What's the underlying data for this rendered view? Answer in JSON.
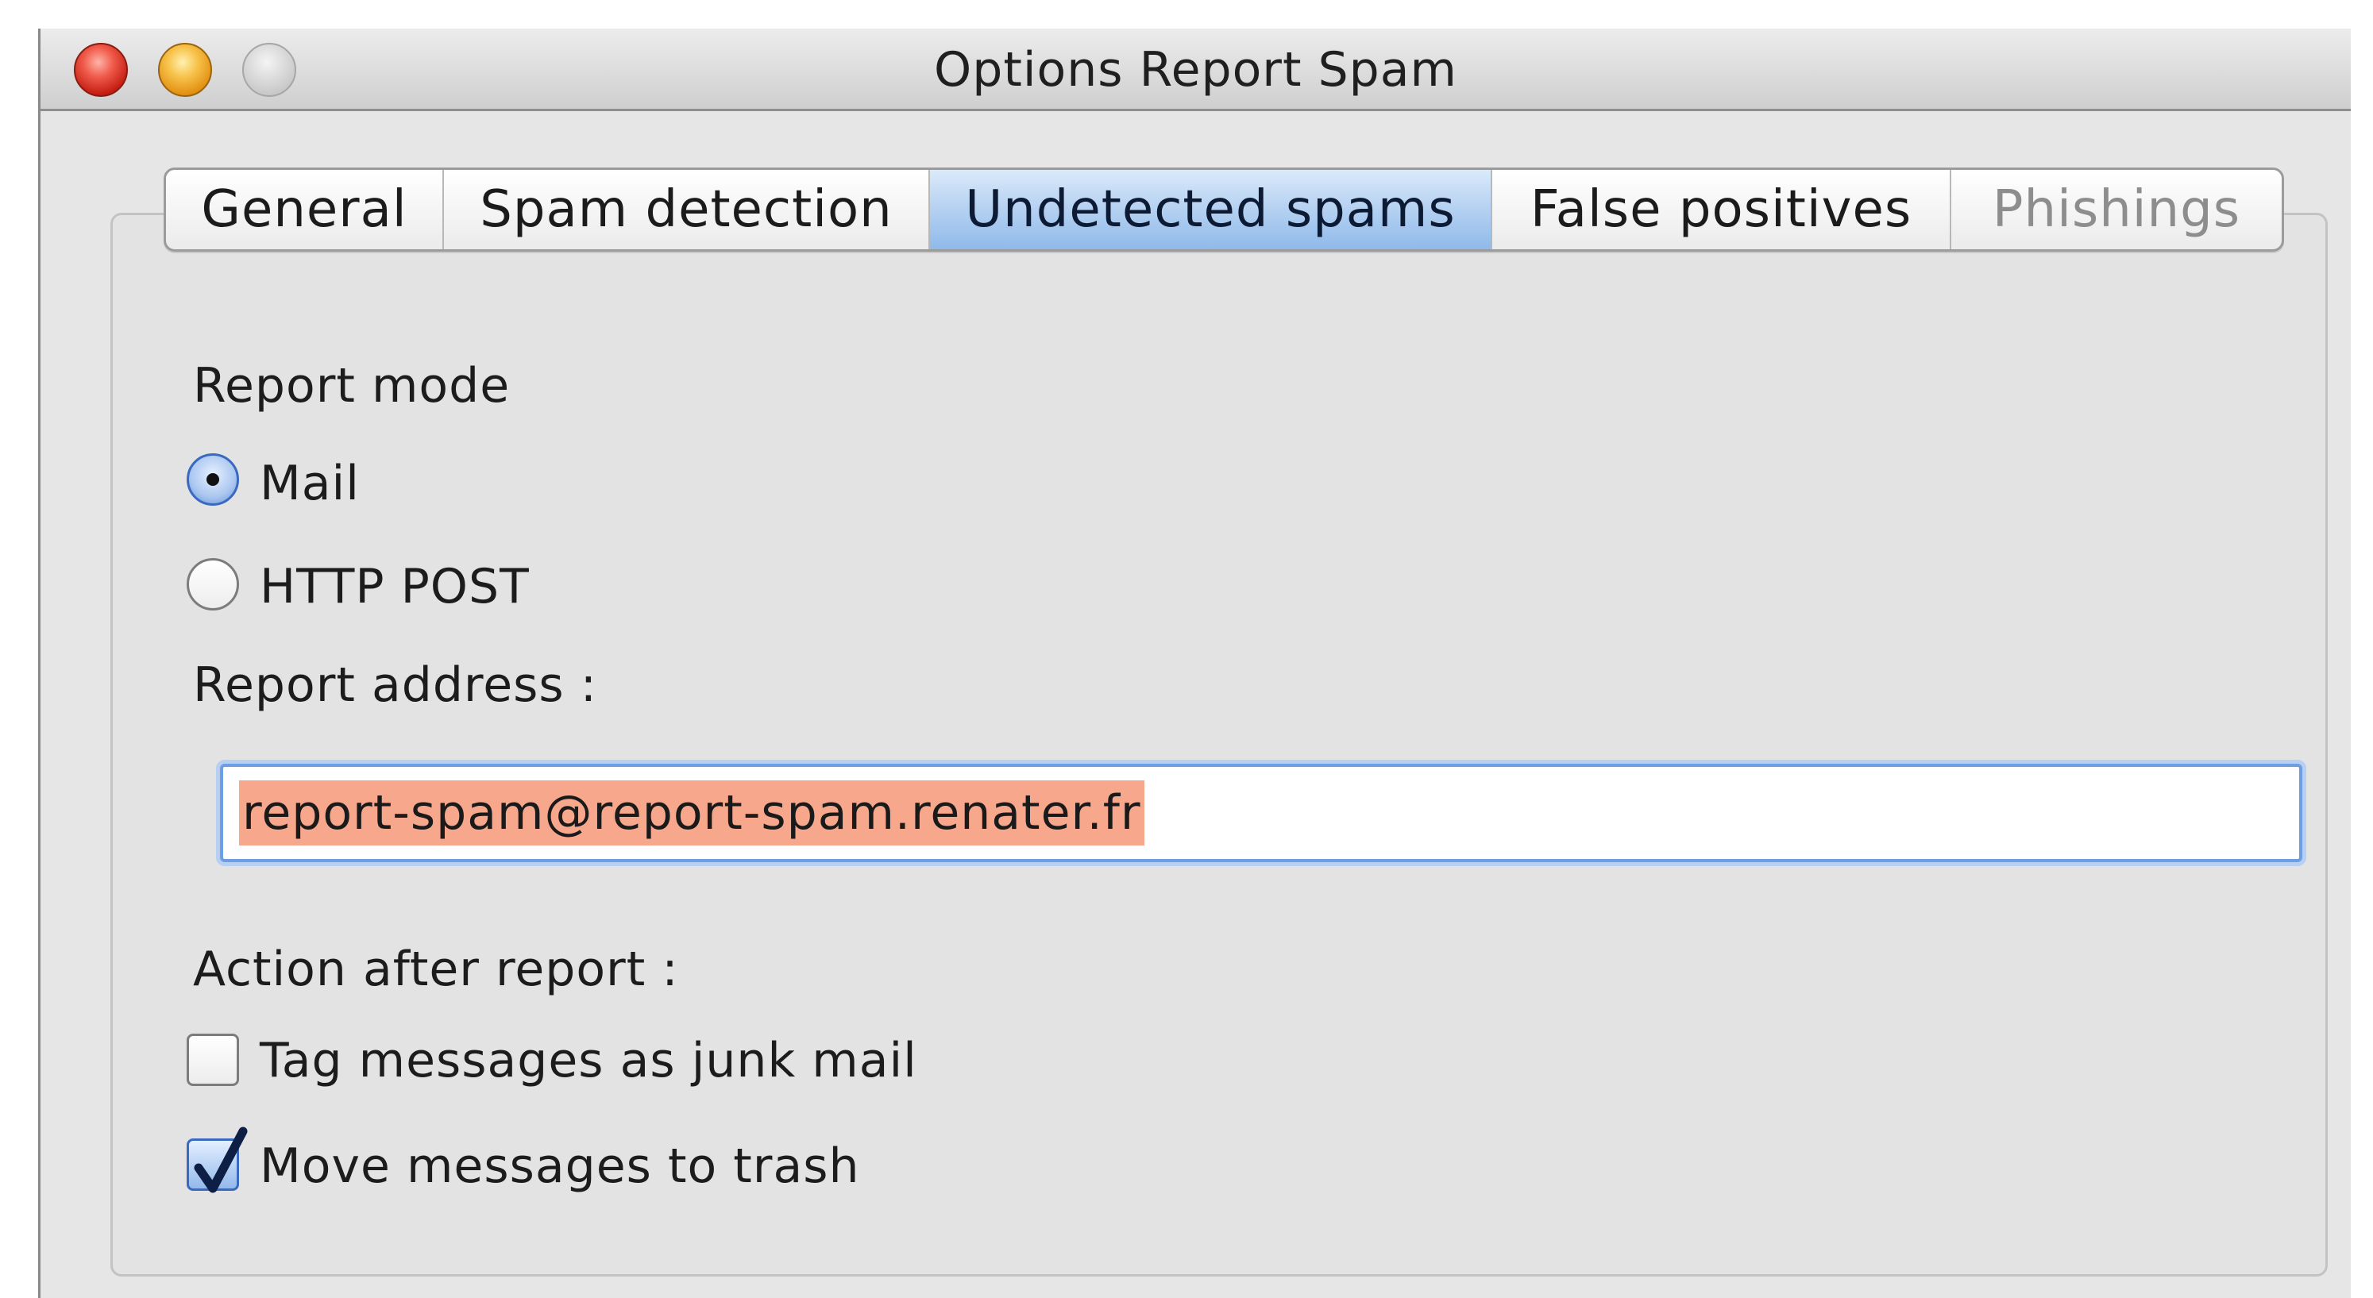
{
  "window": {
    "title": "Options Report Spam"
  },
  "tabs": [
    {
      "label": "General",
      "state": "normal"
    },
    {
      "label": "Spam detection",
      "state": "normal"
    },
    {
      "label": "Undetected spams",
      "state": "active"
    },
    {
      "label": "False positives",
      "state": "normal"
    },
    {
      "label": "Phishings",
      "state": "disabled"
    }
  ],
  "report_mode": {
    "label": "Report mode",
    "options": [
      {
        "label": "Mail",
        "selected": true
      },
      {
        "label": "HTTP POST",
        "selected": false
      }
    ]
  },
  "report_address": {
    "label": "Report address :",
    "value": "report-spam@report-spam.renater.fr"
  },
  "action_after_report": {
    "label": "Action after report :",
    "options": [
      {
        "label": "Tag messages as junk mail",
        "checked": false
      },
      {
        "label": "Move messages to trash",
        "checked": true
      }
    ]
  },
  "colors": {
    "active_tab": "#b8d3f2",
    "selection_highlight": "#f6a78c",
    "focus_ring": "#6e9ee2"
  }
}
